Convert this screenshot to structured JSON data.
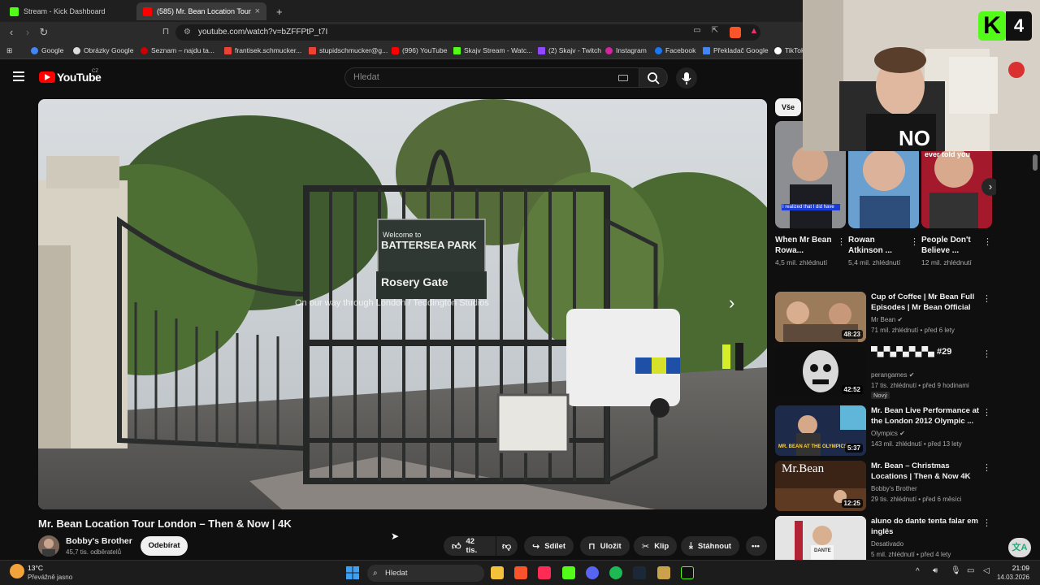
{
  "browser": {
    "tabs": [
      {
        "label": "Stream - Kick Dashboard",
        "active": false
      },
      {
        "label": "(585) Mr. Bean Location Tour",
        "active": true
      }
    ],
    "new_tab": "+",
    "url": "youtube.com/watch?v=bZFFPtP_t7I",
    "bookmarks": [
      "Google",
      "Obrázky Google",
      "Seznam – najdu ta...",
      "frantisek.schmucker...",
      "stupidschmucker@g...",
      "(996) YouTube",
      "Skajv Stream - Watc...",
      "(2) Skajv - Twitch",
      "Instagram",
      "Facebook",
      "Překladač Google",
      "TikTok"
    ]
  },
  "youtube": {
    "logo": "YouTube",
    "country": "CZ",
    "search_placeholder": "Hledat"
  },
  "video": {
    "caption": "On our way through London",
    "caption_tail": "Teddington Studios",
    "sign_line1": "Welcome to",
    "sign_line2": "BATTERSEA PARK",
    "sign_line3": "Rosery Gate",
    "title": "Mr. Bean Location Tour London – Then & Now | 4K",
    "channel": "Bobby's Brother",
    "subscribers": "45,7 tis. odběratelů",
    "subscribe": "Odebírat",
    "likes": "42 tis.",
    "share": "Sdílet",
    "save": "Uložit",
    "clip": "Klip",
    "download": "Stáhnout"
  },
  "sidebar": {
    "chip": "Vše",
    "shorts": [
      {
        "title": "When Mr Bean Rowa...",
        "views": "4,5 mil. zhlédnutí",
        "overlay": "I realized that I did have"
      },
      {
        "title": "Rowan Atkinson ...",
        "views": "5,4 mil. zhlédnutí",
        "overlay": ""
      },
      {
        "title": "People Don't Believe ...",
        "views": "12 mil. zhlédnutí",
        "overlay": "ever told you"
      }
    ],
    "recs": [
      {
        "title": "Cup of Coffee | Mr Bean Full Episodes | Mr Bean Official",
        "channel": "Mr Bean",
        "meta": "71 mil. zhlédnutí • před 6 lety",
        "duration": "48:23",
        "badge": "",
        "color": "#8a6a4a"
      },
      {
        "title": "▀▄▀▄▀▄▀▄▀▄ #29",
        "channel": "perangames",
        "meta": "17 tis. zhlédnutí • před 9 hodinami",
        "duration": "42:52",
        "badge": "Nový",
        "color": "#1a1a1a"
      },
      {
        "title": "Mr. Bean Live Performance at the London 2012 Olympic ...",
        "channel": "Olympics",
        "meta": "143 mil. zhlédnutí • před 13 lety",
        "duration": "5:37",
        "badge": "",
        "color": "#223355",
        "thumb_text": "MR. BEAN AT THE OLYMPICS"
      },
      {
        "title": "Mr. Bean – Christmas Locations | Then & Now 4K",
        "channel": "Bobby's Brother",
        "meta": "29 tis. zhlédnutí • před 6 měsíci",
        "duration": "12:25",
        "badge": "",
        "color": "#4a2a1a",
        "thumb_text": "Mr.Bean"
      },
      {
        "title": "aluno do dante tenta falar em inglês",
        "channel": "Desativado",
        "meta": "5 mil. zhlédnutí • před 4 lety",
        "duration": "",
        "badge": "",
        "color": "#dddddd",
        "thumb_text": "DANTE"
      }
    ]
  },
  "webcam": {
    "badge": "K",
    "badge_num": "4",
    "shirt_text": "NO"
  },
  "taskbar": {
    "weather_temp": "13°C",
    "weather_desc": "Převážně jasno",
    "search": "Hledat",
    "time": "21:09",
    "date": "14.03.2026"
  },
  "colors": {
    "youtube_red": "#ff0000",
    "kick_green": "#53fc18",
    "bg": "#0f0f0f"
  }
}
